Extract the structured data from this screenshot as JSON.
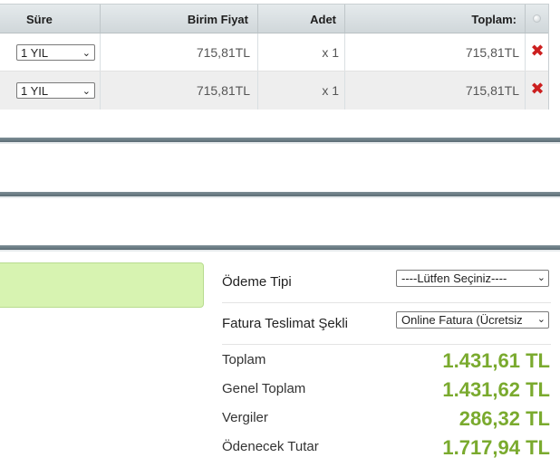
{
  "cart": {
    "headers": {
      "duration": "Süre",
      "unit_price": "Birim Fiyat",
      "quantity": "Adet",
      "total": "Toplam:"
    },
    "rows": [
      {
        "duration": "1 YIL",
        "unit_price": "715,81TL",
        "quantity": "x 1",
        "total": "715,81TL"
      },
      {
        "duration": "1 YIL",
        "unit_price": "715,81TL",
        "quantity": "x 1",
        "total": "715,81TL"
      }
    ]
  },
  "payment": {
    "type_label": "Ödeme Tipi",
    "type_value": "----Lütfen Seçiniz----",
    "invoice_label": "Fatura Teslimat Şekli",
    "invoice_value": "Online Fatura (Ücretsiz"
  },
  "summary": {
    "subtotal_label": "Toplam",
    "subtotal_value": "1.431,61 TL",
    "grand_total_label": "Genel Toplam",
    "grand_total_value": "1.431,62 TL",
    "taxes_label": "Vergiler",
    "taxes_value": "286,32 TL",
    "payable_label": "Ödenecek Tutar",
    "payable_value": "1.717,94 TL"
  },
  "icons": {
    "delete": "delete-icon",
    "dropdown": "chevron-down-icon"
  },
  "colors": {
    "accent_green": "#7aaa2e",
    "delete_red": "#cc1f1f",
    "notice_bg": "#d7f3b1"
  }
}
